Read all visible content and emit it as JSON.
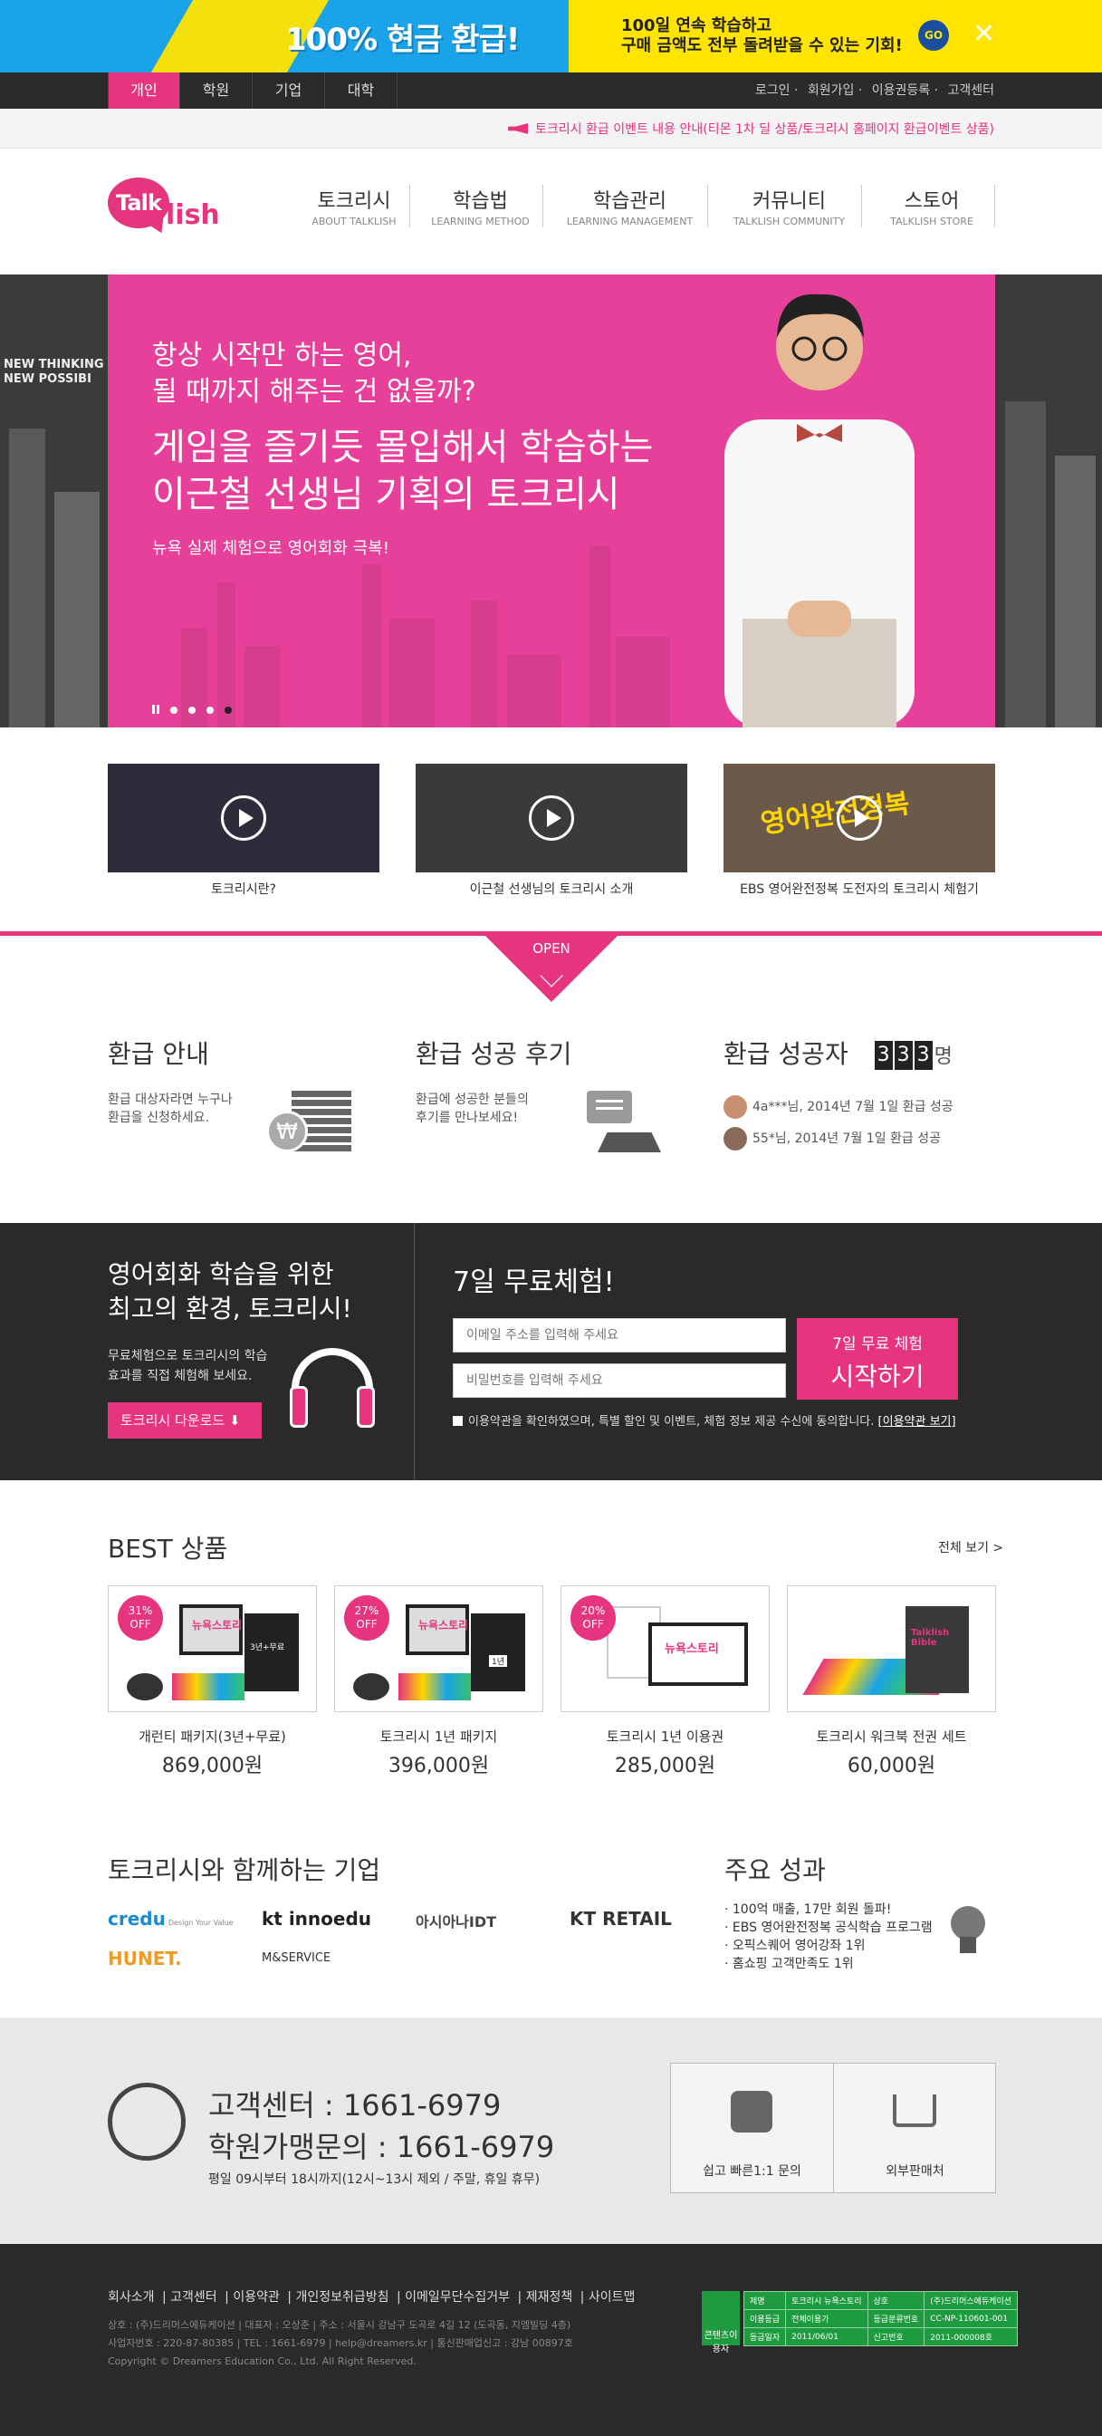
{
  "promo": {
    "title": "100% 현금 환급!",
    "subtitle_line1": "100일 연속 학습하고",
    "subtitle_line2": "구매 금액도 전부 돌려받을 수 있는 기회!",
    "go_label": "GO",
    "close_label": "✕"
  },
  "topnav": {
    "tabs": [
      "개인",
      "학원",
      "기업",
      "대학"
    ],
    "links": [
      "로그인",
      "회원가입",
      "이용권등록",
      "고객센터"
    ]
  },
  "notice": "토크리시 환급 이벤트 내용 안내(티몬 1차 딜 상품/토크리시 홈페이지 환급이벤트 상품)",
  "logo": {
    "talk": "Talk",
    "lish": "lish"
  },
  "gnb": [
    {
      "ko": "토크리시",
      "en": "ABOUT TALKLISH"
    },
    {
      "ko": "학습법",
      "en": "LEARNING METHOD"
    },
    {
      "ko": "학습관리",
      "en": "LEARNING MANAGEMENT"
    },
    {
      "ko": "커뮤니티",
      "en": "TALKLISH COMMUNITY"
    },
    {
      "ko": "스토어",
      "en": "TALKLISH STORE"
    }
  ],
  "hero": {
    "line1": "항상 시작만 하는 영어,",
    "line2": "될 때까지 해주는 건 없을까?",
    "line3": "게임을 즐기듯 몰입해서 학습하는",
    "line4": "이근철 선생님 기획의 토크리시",
    "line5": "뉴욕 실제 체험으로 영어회화 극복!",
    "bg_text": "NEW THINKING\nNEW POSSIBI"
  },
  "videos": [
    {
      "caption": "토크리시란?"
    },
    {
      "caption": "이근철 선생님의 토크리시 소개"
    },
    {
      "caption": "EBS 영어완전정복 도전자의 토크리시 체험기",
      "thumb_text": "영어완전정복"
    }
  ],
  "open_label": "OPEN",
  "refund": {
    "guide_title": "환급 안내",
    "guide_desc1": "환급 대상자라면 누구나",
    "guide_desc2": "환급을 신청하세요.",
    "won_symbol": "₩",
    "review_title": "환급 성공 후기",
    "review_desc1": "환급에 성공한 분들의",
    "review_desc2": "후기를 만나보세요!",
    "winner_title": "환급 성공자",
    "count_digits": [
      "3",
      "3",
      "3"
    ],
    "count_unit": "명",
    "winners": [
      "4a***님, 2014년 7월 1일 환급 성공",
      "55*님, 2014년 7월 1일 환급 성공"
    ]
  },
  "trial": {
    "title1": "영어회화 학습을 위한",
    "title2": "최고의 환경, 토크리시!",
    "desc1": "무료체험으로 토크리시의 학습",
    "desc2": "효과를 직접 체험해 보세요.",
    "download": "토크리시 다운로드",
    "title": "7일 무료체험!",
    "email_placeholder": "이메일 주소를 입력해 주세요",
    "password_placeholder": "비밀번호를 입력해 주세요",
    "start_line1": "7일 무료 체험",
    "start_line2": "시작하기",
    "agree_text": "이용약관을 확인하였으며, 특별 할인 및 이벤트, 체험 정보 제공 수신에 동의합니다.",
    "agree_link": "[이용약관 보기]"
  },
  "best": {
    "title": "BEST 상품",
    "view_all": "전체 보기 >",
    "products": [
      {
        "badge": "31%",
        "off": "OFF",
        "name": "개런티 패키지(3년+무료)",
        "price": "869,000원",
        "img_text": "뉴욕스토리",
        "tag": "3년+무료"
      },
      {
        "badge": "27%",
        "off": "OFF",
        "name": "토크리시 1년 패키지",
        "price": "396,000원",
        "img_text": "뉴욕스토리",
        "tag": "1년"
      },
      {
        "badge": "20%",
        "off": "OFF",
        "name": "토크리시 1년 이용권",
        "price": "285,000원",
        "img_text": "뉴욕스토리"
      },
      {
        "name": "토크리시 워크북 전권 세트",
        "price": "60,000원",
        "img_text": "Talklish Bible"
      }
    ]
  },
  "partners": {
    "title": "토크리시와 함께하는 기업",
    "logos": [
      "credu",
      "kt innoedu",
      "아시아나IDT",
      "KT RETAIL",
      "HUNET.",
      "M&SERVICE"
    ],
    "credu_tag": "Design Your Value"
  },
  "achievements": {
    "title": "주요 성과",
    "items": [
      "· 100억 매출, 17만 회원 돌파!",
      "· EBS 영어완전정복 공식학습 프로그램",
      "· 오픽스퀘어 영어강좌 1위",
      "· 홈쇼핑 고객만족도 1위"
    ]
  },
  "customer": {
    "center": "고객센터 : 1661-6979",
    "academy": "학원가맹문의 : 1661-6979",
    "hours": "평일 09시부터 18시까지(12시~13시 제외 / 주말, 휴일 휴무)",
    "inquiry": "쉽고 빠른1:1 문의",
    "shop": "외부판매처"
  },
  "footer": {
    "links": [
      "회사소개",
      "고객센터",
      "이용약관",
      "개인정보취급방침",
      "이메일무단수집거부",
      "제재정책",
      "사이트맵"
    ],
    "info1": "상호 : (주)드리머스에듀케이션 | 대표자 : 오상준 | 주소 : 서울시 강남구 도곡로 4길 12 (도곡동, 지엠빌딩 4층)",
    "info2": "사업자번호 : 220-87-80385 | TEL : 1661-6979 | help@dreamers.kr | 통신판매업신고 : 강남 00897호",
    "info3": "Copyright © Dreamers Education Co., Ltd. All Right Reserved.",
    "cert_mark": "콘텐츠이용자",
    "cert": [
      [
        "제명",
        "토크리시 뉴욕스토리",
        "상호",
        "(주)드리머스에듀케이션"
      ],
      [
        "이용등급",
        "전체이용가",
        "등급분류번호",
        "CC-NP-110601-001"
      ],
      [
        "등급일자",
        "2011/06/01",
        "신고번호",
        "2011-000008호"
      ]
    ]
  }
}
